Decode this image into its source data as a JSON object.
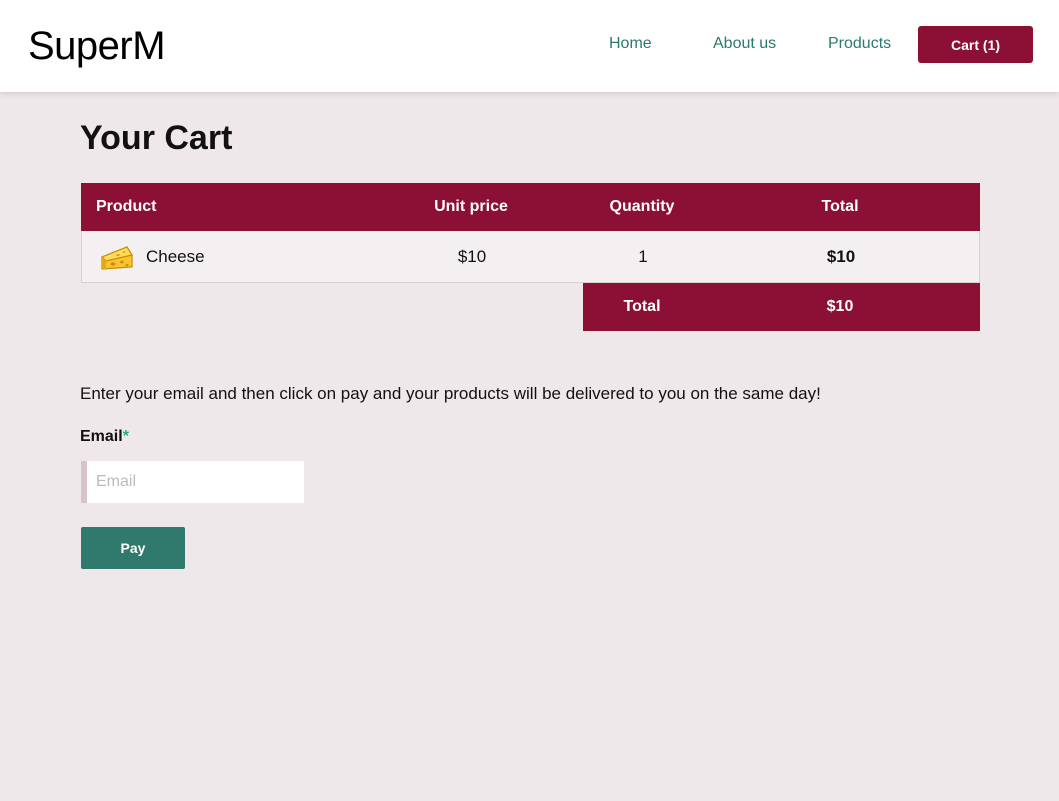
{
  "header": {
    "brand": "SuperM",
    "nav": {
      "home": "Home",
      "about": "About us",
      "products": "Products"
    },
    "cart_button": "Cart (1)"
  },
  "main": {
    "title": "Your Cart",
    "table": {
      "columns": {
        "product": "Product",
        "unit_price": "Unit price",
        "quantity": "Quantity",
        "total": "Total"
      },
      "rows": [
        {
          "icon": "cheese-icon",
          "name": "Cheese",
          "unit_price": "$10",
          "quantity": "1",
          "total": "$10"
        }
      ],
      "footer": {
        "label": "Total",
        "value": "$10"
      }
    },
    "instructions": "Enter your email and then click on pay and your products will be delivered to you on the same day!",
    "email": {
      "label": "Email",
      "required_mark": "*",
      "placeholder": "Email",
      "value": ""
    },
    "pay_button": "Pay"
  },
  "colors": {
    "brand_primary": "#8b1034",
    "accent_green": "#2f7a6d",
    "link_green": "#2b7a6b",
    "background": "#efe8ea"
  }
}
